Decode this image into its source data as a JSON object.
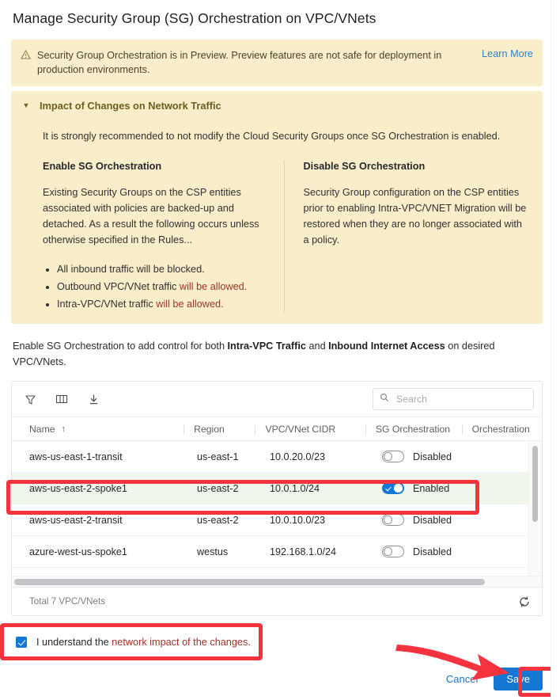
{
  "page_title": "Manage Security Group (SG) Orchestration on VPC/VNets",
  "preview_banner": {
    "icon": "warning-triangle-icon",
    "message": "Security Group Orchestration is in Preview. Preview features are not safe for deployment in production environments.",
    "link_label": "Learn More",
    "background_color": "#faeeca",
    "text_color": "#4a4228",
    "link_color": "#2f7fc4"
  },
  "accordion": {
    "title": "Impact of Changes on Network Traffic",
    "expanded": true,
    "caret_icon": "chevron-down-icon",
    "intro": "It is strongly recommended to not modify the Cloud Security Groups once SG Orchestration is enabled.",
    "left_column": {
      "heading": "Enable SG Orchestration",
      "body": "Existing Security Groups on the CSP entities associated with policies are backed-up and detached. As a result the following occurs unless otherwise specified in the Rules...",
      "bullets": [
        {
          "prefix": "All inbound traffic will be blocked.",
          "highlight": ""
        },
        {
          "prefix": "Outbound VPC/VNet traffic ",
          "highlight": "will be allowed."
        },
        {
          "prefix": "Intra-VPC/VNet traffic ",
          "highlight": "will be allowed."
        }
      ]
    },
    "right_column": {
      "heading": "Disable SG Orchestration",
      "body": "Security Group configuration on the CSP entities prior to enabling Intra-VPC/VNET Migration will be restored when they are no longer associated with a policy."
    },
    "highlight_color": "#9d3227"
  },
  "lead_paragraph": {
    "part1": "Enable SG Orchestration to add control for both ",
    "bold1": "Intra-VPC Traffic",
    "part2": " and ",
    "bold2": "Inbound Internet Access",
    "part3": " on desired VPC/VNets."
  },
  "table": {
    "toolbar": {
      "filter_icon": "filter-icon",
      "columns_icon": "columns-icon",
      "download_icon": "download-icon"
    },
    "search": {
      "placeholder": "Search",
      "value": "",
      "icon": "search-icon"
    },
    "columns": [
      {
        "key": "name",
        "label": "Name",
        "sorted": true,
        "sort_icon": "sort-ascending-arrow"
      },
      {
        "key": "region",
        "label": "Region"
      },
      {
        "key": "cidr",
        "label": "VPC/VNet CIDR"
      },
      {
        "key": "sg_orchestration",
        "label": "SG Orchestration"
      },
      {
        "key": "orchestration",
        "label": "Orchestration"
      }
    ],
    "rows": [
      {
        "name": "aws-us-east-1-transit",
        "region": "us-east-1",
        "cidr": "10.0.20.0/23",
        "toggle_on": false,
        "toggle_label": "Disabled",
        "highlighted": false
      },
      {
        "name": "aws-us-east-2-spoke1",
        "region": "us-east-2",
        "cidr": "10.0.1.0/24",
        "toggle_on": true,
        "toggle_label": "Enabled",
        "highlighted": true
      },
      {
        "name": "aws-us-east-2-transit",
        "region": "us-east-2",
        "cidr": "10.0.10.0/23",
        "toggle_on": false,
        "toggle_label": "Disabled",
        "highlighted": false
      },
      {
        "name": "azure-west-us-spoke1",
        "region": "westus",
        "cidr": "192.168.1.0/24",
        "toggle_on": false,
        "toggle_label": "Disabled",
        "highlighted": false
      }
    ],
    "footer": {
      "total_text": "Total 7 VPC/VNets",
      "refresh_icon": "refresh-icon"
    },
    "highlight_row_color": "#f1f6ec",
    "toggle_on_color": "#1577d4"
  },
  "acknowledgement": {
    "checked": true,
    "text_plain": "I understand the ",
    "text_link": "network impact of the changes.",
    "link_color": "#9d3227",
    "checkbox_color": "#1577d4"
  },
  "footer_buttons": {
    "cancel_label": "Cancel",
    "save_label": "Save",
    "save_color": "#1577d4",
    "cancel_color": "#1a73c4"
  },
  "annotations": {
    "color": "#f5333f",
    "boxes": [
      "highlighted-table-row",
      "acknowledgement-checkbox",
      "save-button"
    ],
    "arrow": "arrow-pointing-to-save-button"
  }
}
